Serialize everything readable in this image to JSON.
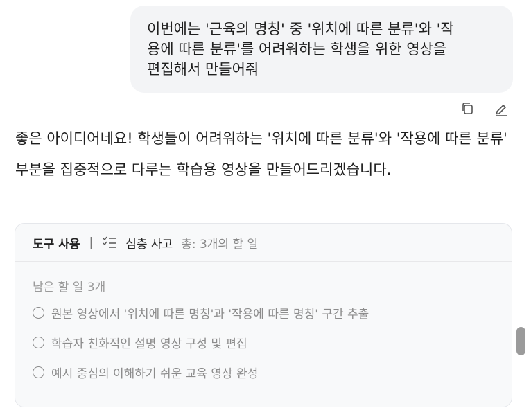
{
  "user_message": {
    "text": "이번에는 '근육의 명칭' 중 '위치에 따른 분류'와 '작\n용에 따른 분류'를 어려워하는 학생을 위한 영상을\n편집해서 만들어줘"
  },
  "message_actions": {
    "copy_icon": "copy-icon",
    "edit_icon": "pencil-icon"
  },
  "assistant_reply": {
    "text": "좋은 아이디어네요! 학생들이 어려워하는 '위치에 따른 분류'와 '작용에 따른 분류' 부분을 집중적으로 다루는 학습용 영상을 만들어드리겠습니다."
  },
  "tool_card": {
    "label": "도구 사용",
    "separator": "|",
    "tool_icon": "checklist-icon",
    "tool_name": "심층 사고",
    "summary": "총: 3개의 할 일",
    "remaining": "남은 할 일 3개",
    "todos": [
      {
        "text": "원본 영상에서 '위치에 따른 명칭'과 '작용에 따른 명칭' 구간 추출"
      },
      {
        "text": "학습자 친화적인 설명 영상 구성 및 편집"
      },
      {
        "text": "예시 중심의 이해하기 쉬운 교육 영상 완성"
      }
    ]
  }
}
